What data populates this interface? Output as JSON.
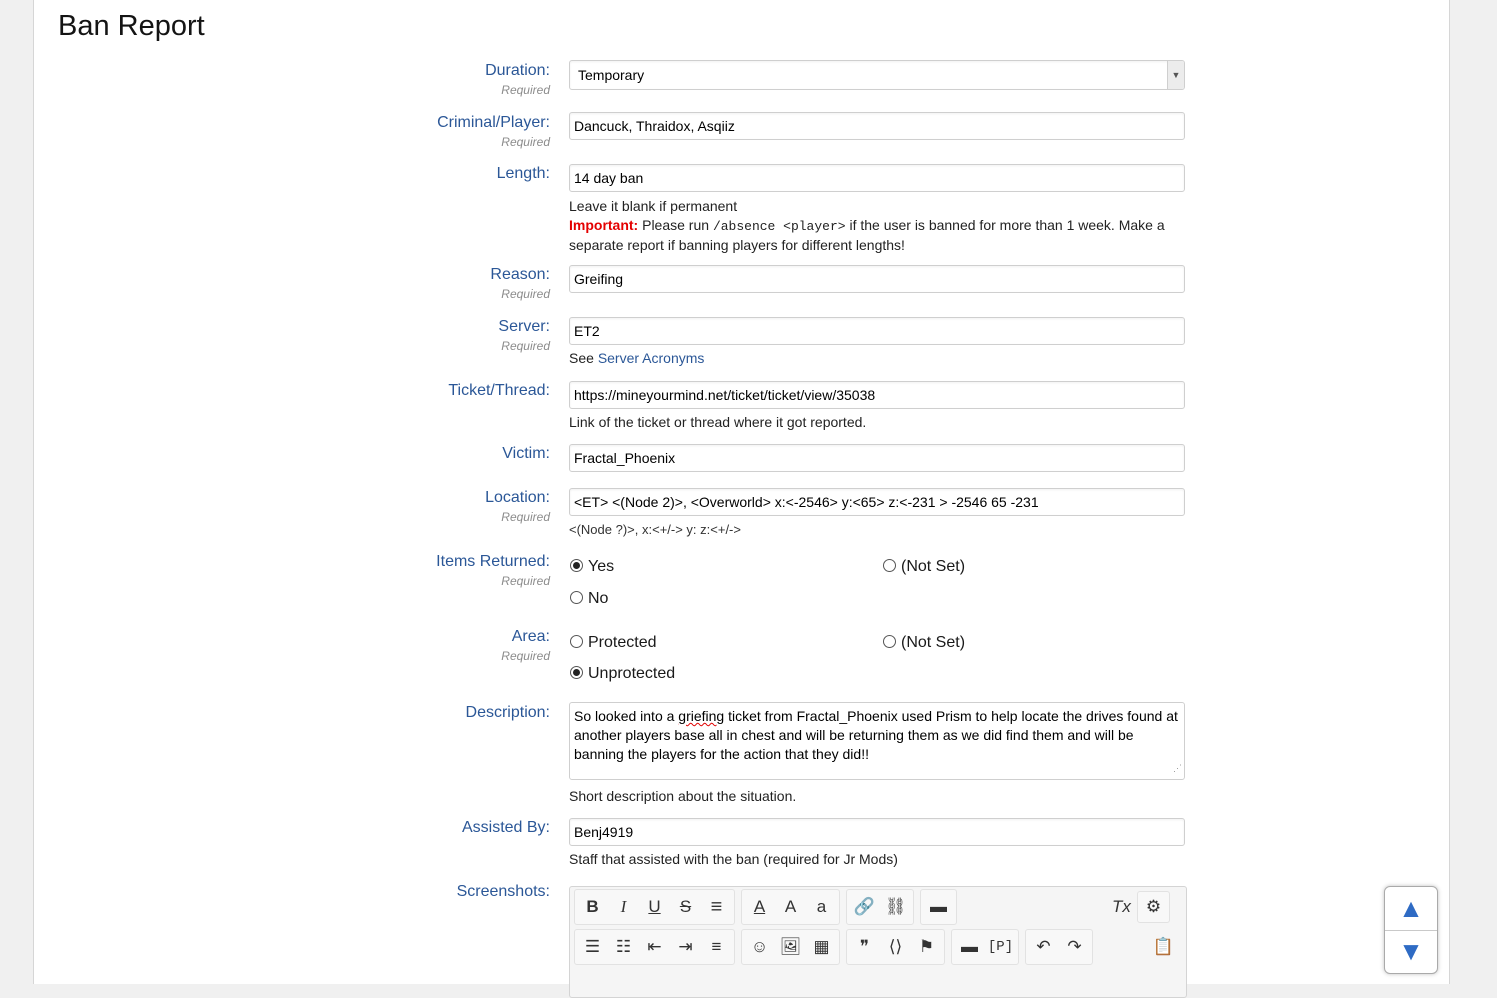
{
  "page_title": "Ban Report",
  "required_text": "Required",
  "duration": {
    "label": "Duration:",
    "value": "Temporary"
  },
  "criminal": {
    "label": "Criminal/Player:",
    "value": "Dancuck, Thraidox, Asqiiz"
  },
  "length": {
    "label": "Length:",
    "value": "14 day ban",
    "hint": "Leave it blank if permanent",
    "important_label": "Important:",
    "important_pre": "Please run",
    "important_code": "/absence <player>",
    "important_post": "if the user is banned for more than 1 week. Make a separate report if banning players for different lengths!"
  },
  "reason": {
    "label": "Reason:",
    "value": "Greifing"
  },
  "server": {
    "label": "Server:",
    "value": "ET2",
    "hint_prefix": "See",
    "hint_link": "Server Acronyms"
  },
  "ticket": {
    "label": "Ticket/Thread:",
    "value": "https://mineyourmind.net/ticket/ticket/view/35038",
    "hint": "Link of the ticket or thread where it got reported."
  },
  "victim": {
    "label": "Victim:",
    "value": "Fractal_Phoenix"
  },
  "location": {
    "label": "Location:",
    "value": "<ET> <(Node 2)>, <Overworld> x:<-2546> y:<65> z:<-231 > -2546 65 -231",
    "hint": "<(Node ?)>, x:<+/-> y: z:<+/->"
  },
  "items_returned": {
    "label": "Items Returned:",
    "options": [
      "Yes",
      "(Not Set)",
      "No"
    ],
    "selected": "Yes"
  },
  "area": {
    "label": "Area:",
    "options": [
      "Protected",
      "(Not Set)",
      "Unprotected"
    ],
    "selected": "Unprotected"
  },
  "description": {
    "label": "Description:",
    "pre": "So looked into a ",
    "misspelled": "griefing",
    "post": " ticket from Fractal_Phoenix used Prism to help locate the drives found at another players base all in chest and will be returning them as we did find them and will be banning the players for the action that they did!!",
    "hint": "Short description about the situation."
  },
  "assisted": {
    "label": "Assisted By:",
    "value": "Benj4919",
    "hint": "Staff that assisted with the ban (required for Jr Mods)"
  },
  "screenshots": {
    "label": "Screenshots:"
  },
  "editor_icons": {
    "bold": "B",
    "italic": "I",
    "underline": "U",
    "strike": "S",
    "align_justify": "≡",
    "font_color": "A",
    "font_size": "A",
    "font_family": "a",
    "link": "🔗",
    "unlink": "⛓",
    "media": "▬",
    "remove_format": "Tx",
    "switch_mode": "⚙",
    "bullets": "☰",
    "numbers": "☷",
    "outdent": "⇤",
    "indent": "⇥",
    "align_left": "≡",
    "smilie": "☺",
    "image": "🖼",
    "gallery": "▦",
    "quote": "❞",
    "code": "⟨⟩",
    "flag": "⚑",
    "spoiler": "▬",
    "p_tag": "[P]",
    "undo": "↶",
    "redo": "↷",
    "paste": "📋"
  },
  "scroll_icons": {
    "up": "▲",
    "down": "▼"
  }
}
